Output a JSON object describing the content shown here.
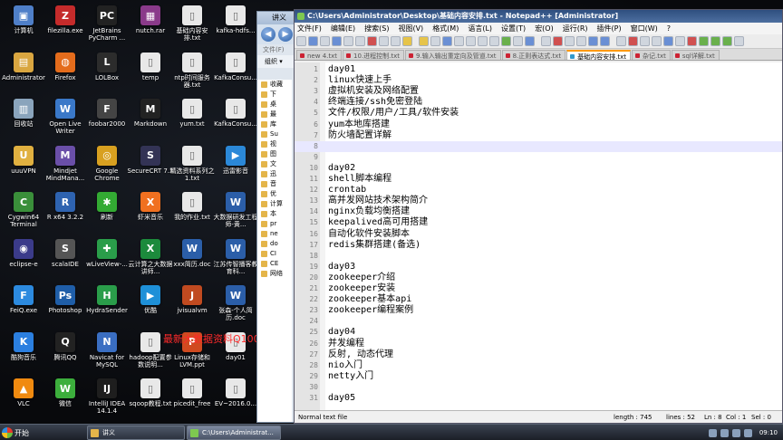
{
  "desktop": {
    "icons": [
      {
        "label": "计算机",
        "glyph": "▣",
        "color": "#4f7fc8"
      },
      {
        "label": "Administrator",
        "glyph": "▤",
        "color": "#d9a640"
      },
      {
        "label": "回收站",
        "glyph": "▥",
        "color": "#8aa4bc"
      },
      {
        "label": "uuuVPN",
        "glyph": "U",
        "color": "#e0b040"
      },
      {
        "label": "Cygwin64 Terminal",
        "glyph": "C",
        "color": "#3a8f3a"
      },
      {
        "label": "eclipse-e",
        "glyph": "◉",
        "color": "#3b3b8a"
      },
      {
        "label": "FeiQ.exe",
        "glyph": "F",
        "color": "#2c8adf"
      },
      {
        "label": "酷狗音乐",
        "glyph": "K",
        "color": "#2b7fe0"
      },
      {
        "label": "VLC",
        "glyph": "▲",
        "color": "#f08a10"
      },
      {
        "label": "filezilla.exe",
        "glyph": "Z",
        "color": "#c52b2b"
      },
      {
        "label": "Firefox",
        "glyph": "◍",
        "color": "#e46c1c"
      },
      {
        "label": "Open Live Writer",
        "glyph": "W",
        "color": "#3a78c8"
      },
      {
        "label": "Mindjet MindMana...",
        "glyph": "M",
        "color": "#6a4fa8"
      },
      {
        "label": "R x64 3.2.2",
        "glyph": "R",
        "color": "#2e63b0"
      },
      {
        "label": "scalaIDE",
        "glyph": "S",
        "color": "#555"
      },
      {
        "label": "Photoshop",
        "glyph": "Ps",
        "color": "#1f5ea8"
      },
      {
        "label": "腾讯QQ",
        "glyph": "Q",
        "color": "#222"
      },
      {
        "label": "微信",
        "glyph": "W",
        "color": "#3cae3c"
      },
      {
        "label": "JetBrains PyCharm ...",
        "glyph": "PC",
        "color": "#222"
      },
      {
        "label": "LOLBox",
        "glyph": "L",
        "color": "#2c2c2c"
      },
      {
        "label": "foobar2000",
        "glyph": "F",
        "color": "#444"
      },
      {
        "label": "Google Chrome",
        "glyph": "◎",
        "color": "#d8a020"
      },
      {
        "label": "刷新",
        "glyph": "✱",
        "color": "#3a3"
      },
      {
        "label": "wLiveView-...",
        "glyph": "✚",
        "color": "#2a9d4a"
      },
      {
        "label": "HydraSender",
        "glyph": "H",
        "color": "#2a9d4a"
      },
      {
        "label": "Navicat for MySQL",
        "glyph": "N",
        "color": "#3a6ec2"
      },
      {
        "label": "IntelliJ IDEA 14.1.4",
        "glyph": "IJ",
        "color": "#1e1e1e"
      },
      {
        "label": "nutch.rar",
        "glyph": "▦",
        "color": "#8a3a8a"
      },
      {
        "label": "temp",
        "glyph": "▯",
        "color": "#e8e8e8"
      },
      {
        "label": "Markdown",
        "glyph": "M",
        "color": "#222"
      },
      {
        "label": "SecureCRT 7.3",
        "glyph": "S",
        "color": "#335"
      },
      {
        "label": "虾米音乐",
        "glyph": "X",
        "color": "#f07020"
      },
      {
        "label": "云计算之大数据讲师...",
        "glyph": "X",
        "color": "#1c8a3c"
      },
      {
        "label": "优酷",
        "glyph": "▶",
        "color": "#1e90d8"
      },
      {
        "label": "hadoop配置参数说明...",
        "glyph": "▯",
        "color": "#e8e8e8"
      },
      {
        "label": "sqoop教程.txt",
        "glyph": "▯",
        "color": "#e8e8e8"
      },
      {
        "label": "基础内容安排.txt",
        "glyph": "▯",
        "color": "#e8e8e8"
      },
      {
        "label": "ntp时间服务器.txt",
        "glyph": "▯",
        "color": "#e8e8e8"
      },
      {
        "label": "yum.txt",
        "glyph": "▯",
        "color": "#e8e8e8"
      },
      {
        "label": "精选资料系列之1.txt",
        "glyph": "▯",
        "color": "#e8e8e8"
      },
      {
        "label": "我的作业.txt",
        "glyph": "▯",
        "color": "#e8e8e8"
      },
      {
        "label": "xxx简历.doc",
        "glyph": "W",
        "color": "#2b5ea8"
      },
      {
        "label": "jvisualvm",
        "glyph": "J",
        "color": "#c04a20"
      },
      {
        "label": "Linux存储和LVM.ppt",
        "glyph": "P",
        "color": "#d04a20"
      },
      {
        "label": "picedit_free",
        "glyph": "▯",
        "color": "#e8e8e8"
      },
      {
        "label": "kafka-hdfs...",
        "glyph": "▯",
        "color": "#e8e8e8"
      },
      {
        "label": "KafkaConsu...",
        "glyph": "▯",
        "color": "#e8e8e8"
      },
      {
        "label": "KafkaConsu...",
        "glyph": "▯",
        "color": "#e8e8e8"
      },
      {
        "label": "迅雷影音",
        "glyph": "▶",
        "color": "#2b88d8"
      },
      {
        "label": "大数据研发工程师-黄...",
        "glyph": "W",
        "color": "#2b5ea8"
      },
      {
        "label": "江苏传智播客教育科...",
        "glyph": "W",
        "color": "#2b5ea8"
      },
      {
        "label": "张森-个人简历.doc",
        "glyph": "W",
        "color": "#2b5ea8"
      },
      {
        "label": "day01",
        "glyph": "▯",
        "color": "#e8e8e8"
      },
      {
        "label": "EV~2016.0...",
        "glyph": "▯",
        "color": "#e8e8e8"
      }
    ],
    "watermark": "最新大数据资料Q1003502880"
  },
  "explorer": {
    "title": "讲义",
    "menu": "文件(F)",
    "organize": "组织 ▾",
    "tree": [
      "收藏",
      "下",
      "桌",
      "最",
      "库",
      "Su",
      "视",
      "图",
      "文",
      "迅",
      "音",
      "优",
      "计算",
      "本",
      "pr",
      "ne",
      "do",
      "CI",
      "CE",
      "网络"
    ]
  },
  "notepad": {
    "title": "C:\\Users\\Administrator\\Desktop\\基础内容安排.txt - Notepad++ [Administrator]",
    "menu": [
      "文件(F)",
      "编辑(E)",
      "搜索(S)",
      "视图(V)",
      "格式(M)",
      "语言(L)",
      "设置(T)",
      "宏(O)",
      "运行(R)",
      "插件(P)",
      "窗口(W)",
      "?"
    ],
    "tabs": [
      "new 4.txt",
      "10.进程控制.txt",
      "9.输入输出重定向及管道.txt",
      "8.正则表达式.txt",
      "基础内容安排.txt",
      "杂记.txt",
      "sql详解.txt"
    ],
    "active_tab_index": 4,
    "current_line": 8,
    "lines": [
      {
        "n": "1",
        "text": "day01"
      },
      {
        "n": "2",
        "text": "linux快速上手"
      },
      {
        "n": "3",
        "text": "虚拟机安装及网络配置"
      },
      {
        "n": "4",
        "text": "终端连接/ssh免密登陆"
      },
      {
        "n": "5",
        "text": "文件/权限/用户/工具/软件安装"
      },
      {
        "n": "6",
        "text": "yum本地库搭建"
      },
      {
        "n": "7",
        "text": "防火墙配置详解"
      },
      {
        "n": "8",
        "text": ""
      },
      {
        "n": "9",
        "text": ""
      },
      {
        "n": "10",
        "text": "day02"
      },
      {
        "n": "11",
        "text": "shell脚本编程"
      },
      {
        "n": "12",
        "text": "crontab"
      },
      {
        "n": "13",
        "text": "高并发网站技术架构简介"
      },
      {
        "n": "14",
        "text": "nginx负载均衡搭建"
      },
      {
        "n": "15",
        "text": "keepalived高可用搭建"
      },
      {
        "n": "16",
        "text": "自动化软件安装脚本"
      },
      {
        "n": "17",
        "text": "redis集群搭建(备选)"
      },
      {
        "n": "18",
        "text": ""
      },
      {
        "n": "19",
        "text": "day03"
      },
      {
        "n": "20",
        "text": "zookeeper介绍"
      },
      {
        "n": "21",
        "text": "zookeeper安装"
      },
      {
        "n": "22",
        "text": "zookeeper基本api"
      },
      {
        "n": "23",
        "text": "zookeeper编程案例"
      },
      {
        "n": "24",
        "text": ""
      },
      {
        "n": "25",
        "text": "day04"
      },
      {
        "n": "26",
        "text": "并发编程"
      },
      {
        "n": "27",
        "text": "反射, 动态代理"
      },
      {
        "n": "28",
        "text": "nio入门"
      },
      {
        "n": "29",
        "text": "netty入门"
      },
      {
        "n": "30",
        "text": ""
      },
      {
        "n": "31",
        "text": "day05"
      }
    ],
    "status": {
      "type": "Normal text file",
      "length": "length : 745",
      "lines": "lines : 52",
      "ln": "Ln : 8",
      "col": "Col : 1",
      "sel": "Sel : 0"
    }
  },
  "taskbar": {
    "start": "开始",
    "tasks": [
      "讲义",
      "C:\\Users\\Administrat..."
    ],
    "clock": "09:10"
  }
}
